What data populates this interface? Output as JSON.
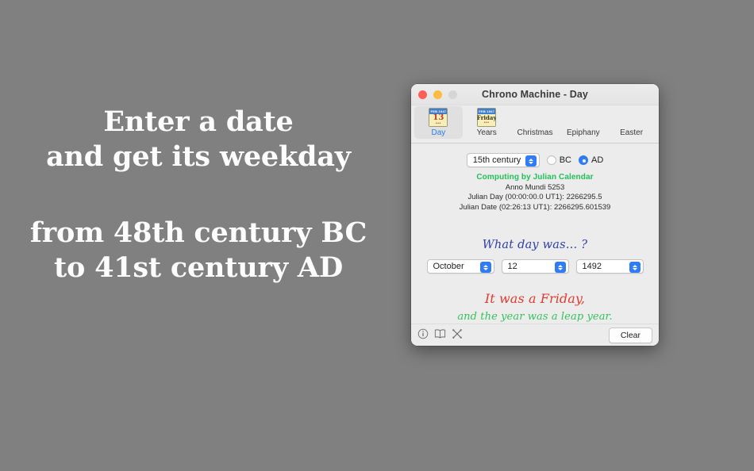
{
  "marketing": {
    "line1": "Enter a date",
    "line2": "and get its weekday",
    "line3": "from 48th century BC",
    "line4": "to 41st century AD"
  },
  "window": {
    "title": "Chrono Machine - Day",
    "traffic_lights": {
      "close": "close-button",
      "minimize": "minimize-button",
      "zoom": "zoom-button"
    }
  },
  "toolbar": {
    "items": [
      {
        "label": "Day",
        "icon": "calendar-day-icon",
        "selected": true,
        "cal_top": "FEB 1947",
        "cal_main": "13",
        "cal_dots": "•••"
      },
      {
        "label": "Years",
        "icon": "calendar-years-icon",
        "selected": false,
        "cal_top": "FEB 1947",
        "cal_main": "Friday",
        "cal_dots": "•••"
      },
      {
        "label": "Christmas",
        "icon": "christmas-painting-icon",
        "selected": false
      },
      {
        "label": "Epiphany",
        "icon": "epiphany-painting-icon",
        "selected": false
      },
      {
        "label": "Easter",
        "icon": "easter-painting-icon",
        "selected": false
      }
    ]
  },
  "century": {
    "selected": "15th century",
    "era_bc_label": "BC",
    "era_ad_label": "AD",
    "era_selected": "AD"
  },
  "info": {
    "heading": "Computing by Julian Calendar",
    "anno_mundi": "Anno Mundi 5253",
    "julian_day": "Julian Day (00:00:00.0 UT1): 2266295.5",
    "julian_date": "Julian Date (02:26:13 UT1): 2266295.601539"
  },
  "question": "What day was… ?",
  "date_inputs": {
    "month": "October",
    "day": "12",
    "year": "1492"
  },
  "answer": {
    "weekday_line": "It was a Friday,",
    "leap_line": "and the year was a leap year."
  },
  "bottom": {
    "info_icon": "info-icon",
    "book_icon": "book-icon",
    "tools_icon": "tools-icon",
    "clear_label": "Clear"
  },
  "colors": {
    "desktop_bg": "#808080",
    "accent_blue": "#2f7cf6",
    "green": "#22c05a",
    "red": "#e03b30",
    "question_blue": "#2f3fa8"
  }
}
